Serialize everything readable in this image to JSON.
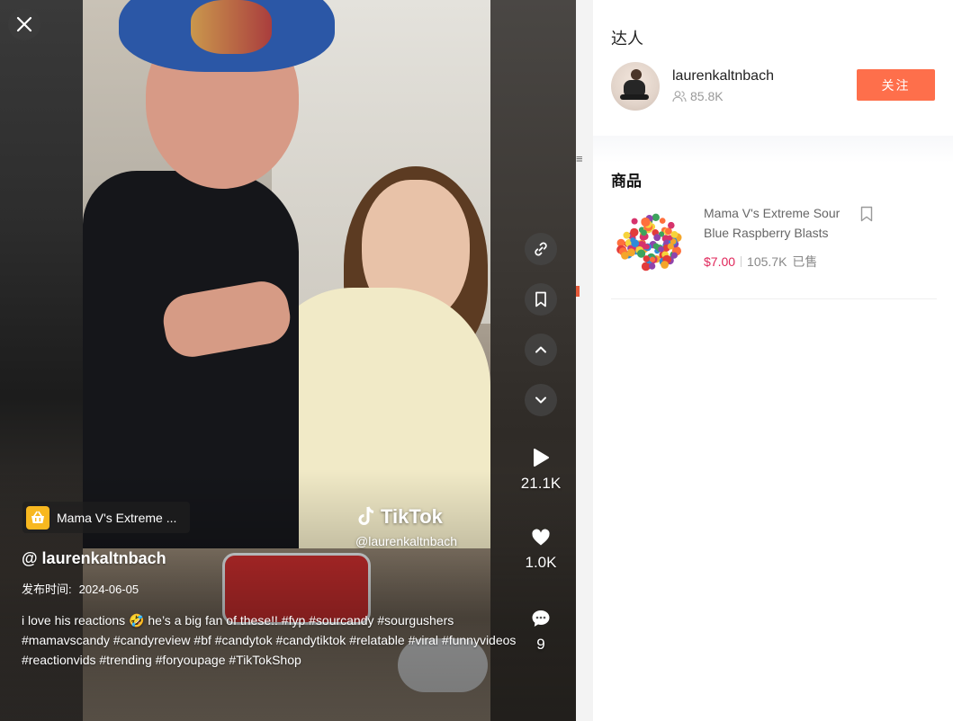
{
  "video": {
    "watermark_brand": "TikTok",
    "watermark_handle": "@laurenkaltnbach",
    "product_chip_label": "Mama V's Extreme ...",
    "author_handle": "@ laurenkaltnbach",
    "publish_label": "发布时间:",
    "publish_date": "2024-06-05",
    "caption": "i love his reactions 🤣 he’s a big fan of these!! #fyp #sourcandy #sourgushers #mamavscandy #candyreview #bf #candytok #candytiktok #relatable #viral #funnyvideos #reactionvids #trending #foryoupage #TikTokShop",
    "stats": {
      "plays": "21.1K",
      "likes": "1.0K",
      "comments": "9"
    },
    "icons": {
      "close": "close-icon",
      "link": "link-icon",
      "bookmark": "bookmark-icon",
      "prev": "chevron-up-icon",
      "next": "chevron-down-icon",
      "plays": "play-icon",
      "likes": "heart-icon",
      "comments": "comment-icon",
      "chip": "shopping-basket-icon"
    }
  },
  "background": {
    "glyph": "≡"
  },
  "panel": {
    "creator_title": "达人",
    "creator_name": "laurenkaltnbach",
    "creator_followers": "85.8K",
    "follow_label": "关注",
    "products_title": "商品",
    "product": {
      "name": "Mama V's Extreme Sour Blue Raspberry Blasts",
      "price": "$7.00",
      "sold_count": "105.7K",
      "sold_label": "已售"
    }
  },
  "colors": {
    "accent": "#fe6f4b",
    "price": "#e0265a",
    "chip_icon_bg": "#f8b820"
  }
}
